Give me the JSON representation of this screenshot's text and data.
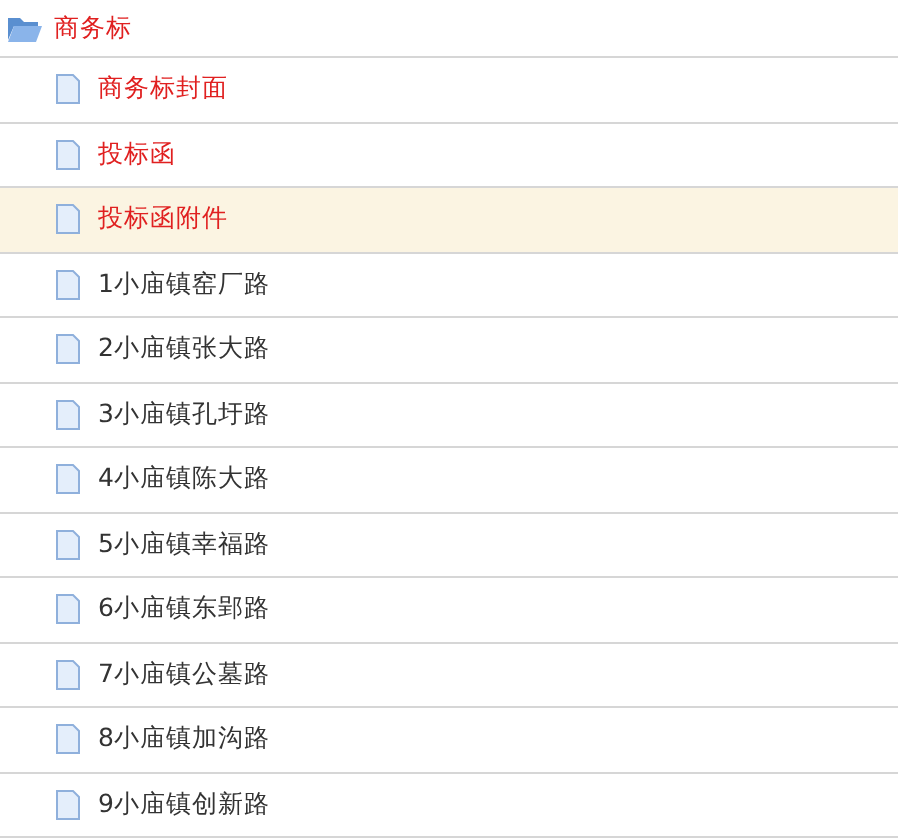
{
  "tree": {
    "label": "商务标",
    "expanded": true,
    "color": "#e02020",
    "children": [
      {
        "label": "商务标封面",
        "color": "#e02020",
        "selected": false
      },
      {
        "label": "投标函",
        "color": "#e02020",
        "selected": false
      },
      {
        "label": "投标函附件",
        "color": "#e02020",
        "selected": true
      },
      {
        "label": "1小庙镇窑厂路",
        "color": "#333333",
        "selected": false
      },
      {
        "label": "2小庙镇张大路",
        "color": "#333333",
        "selected": false
      },
      {
        "label": "3小庙镇孔圩路",
        "color": "#333333",
        "selected": false
      },
      {
        "label": "4小庙镇陈大路",
        "color": "#333333",
        "selected": false
      },
      {
        "label": "5小庙镇幸福路",
        "color": "#333333",
        "selected": false
      },
      {
        "label": "6小庙镇东郢路",
        "color": "#333333",
        "selected": false
      },
      {
        "label": "7小庙镇公墓路",
        "color": "#333333",
        "selected": false
      },
      {
        "label": "8小庙镇加沟路",
        "color": "#333333",
        "selected": false
      },
      {
        "label": "9小庙镇创新路",
        "color": "#333333",
        "selected": false
      }
    ]
  }
}
